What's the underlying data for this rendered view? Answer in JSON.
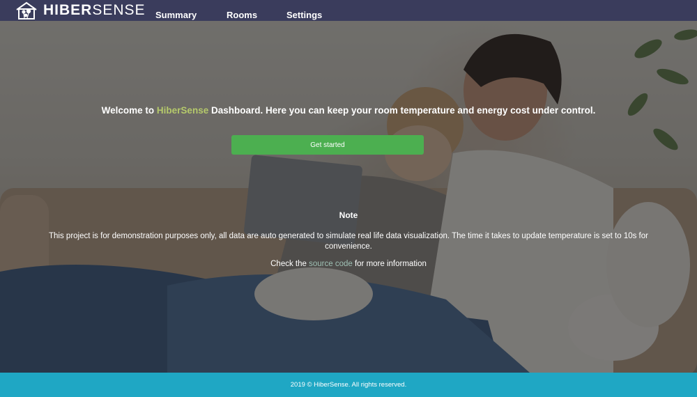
{
  "nav": {
    "logo_part1": "HIBER",
    "logo_part2": "SENSE",
    "links": [
      {
        "label": "Summary"
      },
      {
        "label": "Rooms"
      },
      {
        "label": "Settings"
      }
    ]
  },
  "hero": {
    "welcome_prefix": "Welcome to ",
    "brand": "HiberSense",
    "welcome_suffix": " Dashboard. Here you can keep your room temperature and energy cost under control.",
    "cta_label": "Get started",
    "note_title": "Note",
    "note_body": "This project is for demonstration purposes only, all data are auto generated to simulate real life data visualization. The time it takes to update temperature is set to 10s for convenience.",
    "check_prefix": "Check the ",
    "check_link": "source code",
    "check_suffix": " for more information"
  },
  "footer": {
    "text": "2019 © HiberSense. All rights reserved."
  },
  "colors": {
    "navbar": "#3a3c5c",
    "brand_accent": "#b5c96b",
    "cta": "#4caf50",
    "link": "#9fc0b4",
    "footer": "#1fa7c4"
  },
  "background": "photo-of-couple-on-sofa-with-tablet"
}
